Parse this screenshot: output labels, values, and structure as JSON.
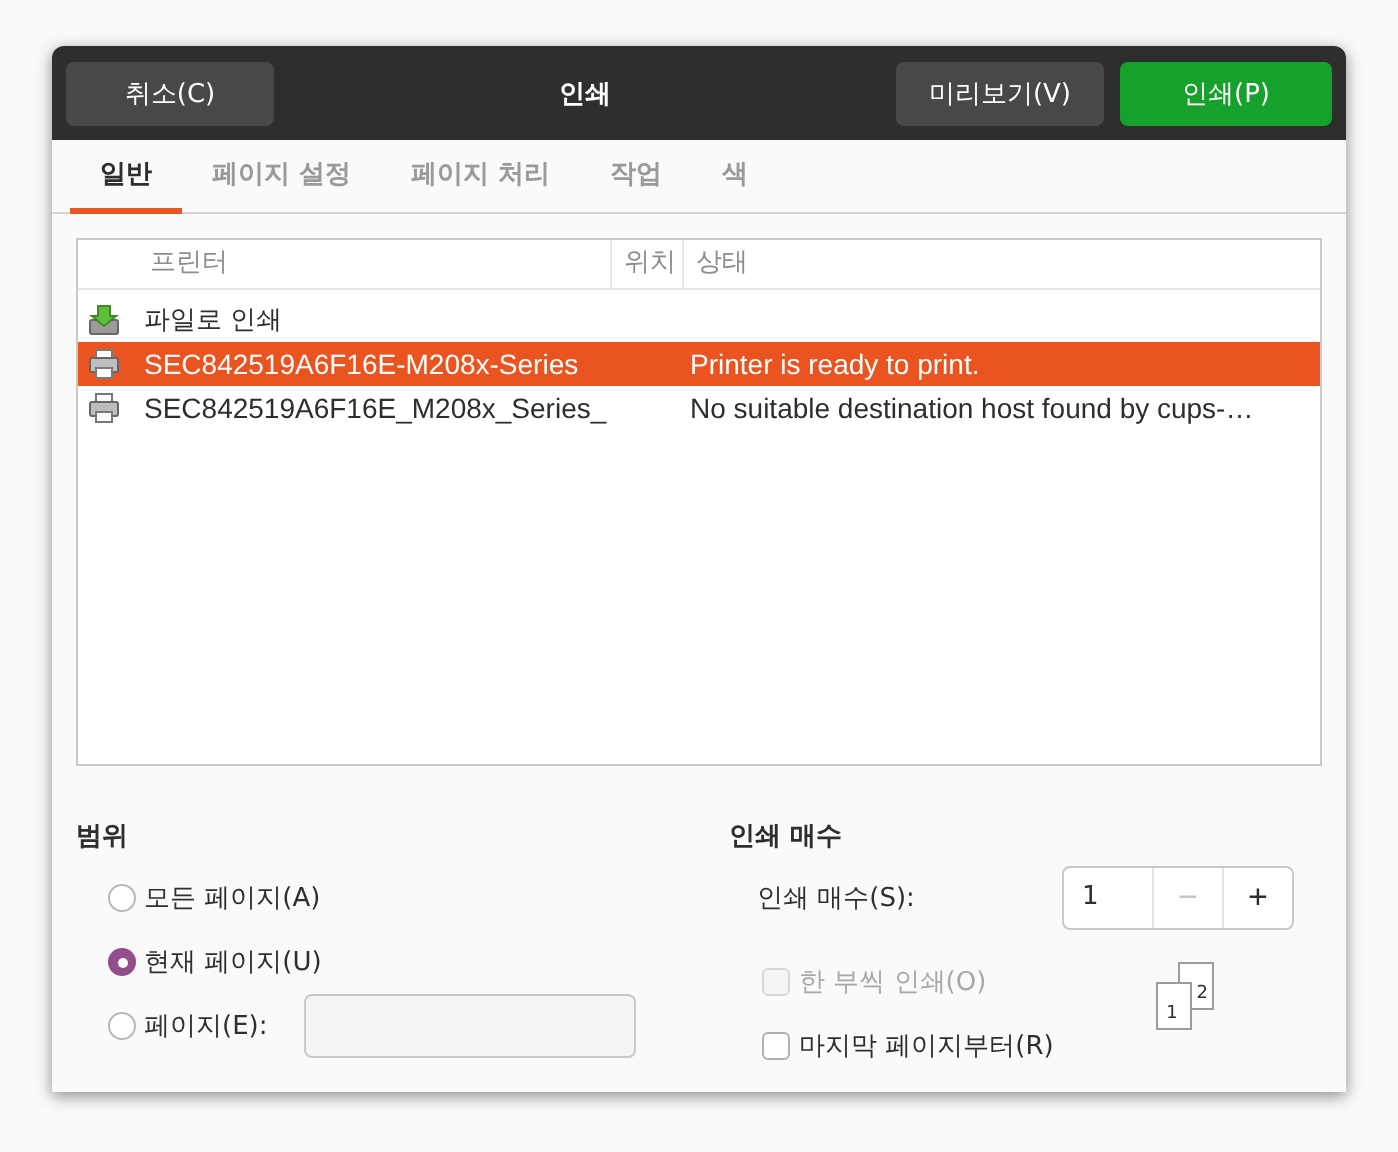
{
  "header": {
    "cancel": "취소(C)",
    "title": "인쇄",
    "preview": "미리보기(V)",
    "print": "인쇄(P)"
  },
  "tabs": [
    {
      "label": "일반",
      "selected": true
    },
    {
      "label": "페이지 설정",
      "selected": false
    },
    {
      "label": "페이지 처리",
      "selected": false
    },
    {
      "label": "작업",
      "selected": false
    },
    {
      "label": "색",
      "selected": false
    }
  ],
  "printers": {
    "columns": [
      "프린터",
      "위치",
      "상태"
    ],
    "rows": [
      {
        "kind": "file",
        "name": "파일로 인쇄",
        "status": "",
        "selected": false
      },
      {
        "kind": "printer",
        "name": "SEC842519A6F16E-M208x-Series",
        "status": "Printer is ready to print.",
        "selected": true
      },
      {
        "kind": "printer",
        "name": "SEC842519A6F16E_M208x_Series_",
        "status": "No suitable destination host found by cups-…",
        "selected": false
      }
    ]
  },
  "range": {
    "title": "범위",
    "options": [
      {
        "label": "모든 페이지(A)",
        "selected": false
      },
      {
        "label": "현재 페이지(U)",
        "selected": true
      },
      {
        "label": "페이지(E):",
        "selected": false
      }
    ]
  },
  "copies": {
    "title": "인쇄 매수",
    "label": "인쇄 매수(S):",
    "value": "1",
    "minus": "−",
    "plus": "+",
    "collate": {
      "label": "한 부씩 인쇄(O)",
      "checked": false,
      "disabled": true
    },
    "reverse": {
      "label": "마지막 페이지부터(R)",
      "checked": false,
      "disabled": false
    },
    "pages": [
      "1",
      "2"
    ]
  }
}
